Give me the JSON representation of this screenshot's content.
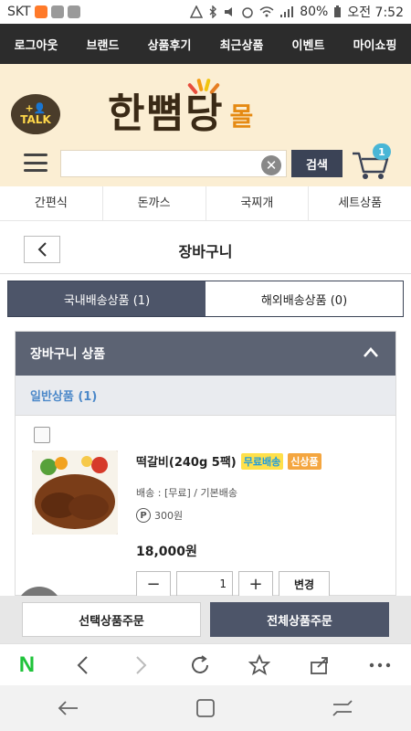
{
  "status_bar": {
    "carrier": "SKT",
    "battery": "80%",
    "time": "오전 7:52"
  },
  "top_nav": [
    "로그아웃",
    "브랜드",
    "상품후기",
    "최근상품",
    "이벤트",
    "마이쇼핑"
  ],
  "header": {
    "talk_label": "TALK",
    "logo_main": "한뼘당",
    "logo_sub": "몰",
    "search": {
      "value": "",
      "placeholder": "",
      "button": "검색"
    },
    "cart_count": "1"
  },
  "categories": [
    "간편식",
    "돈까스",
    "국찌개",
    "세트상품"
  ],
  "page": {
    "title": "장바구니"
  },
  "tabs": [
    {
      "label": "국내배송상품 (1)",
      "active": true
    },
    {
      "label": "해외배송상품 (0)",
      "active": false
    }
  ],
  "cart_section": {
    "title": "장바구니 상품",
    "group": "일반상품 (1)",
    "item": {
      "name": "떡갈비(240g 5팩)",
      "badge_free": "무료배송",
      "badge_new": "신상품",
      "shipping": "배송 : [무료] / 기본배송",
      "points": "300원",
      "price": "18,000원",
      "quantity": "1",
      "change_label": "변경"
    }
  },
  "order_bar": {
    "selected": "선택상품주문",
    "all": "전체상품주문"
  },
  "browser": {
    "n_label": "N"
  },
  "colors": {
    "nav_dark": "#2c2c2c",
    "header_bg": "#fbeed3",
    "accent_dark": "#4d5569",
    "link_blue": "#4b88c9",
    "badge_yellow": "#ffe04a",
    "badge_orange": "#f4a640"
  }
}
